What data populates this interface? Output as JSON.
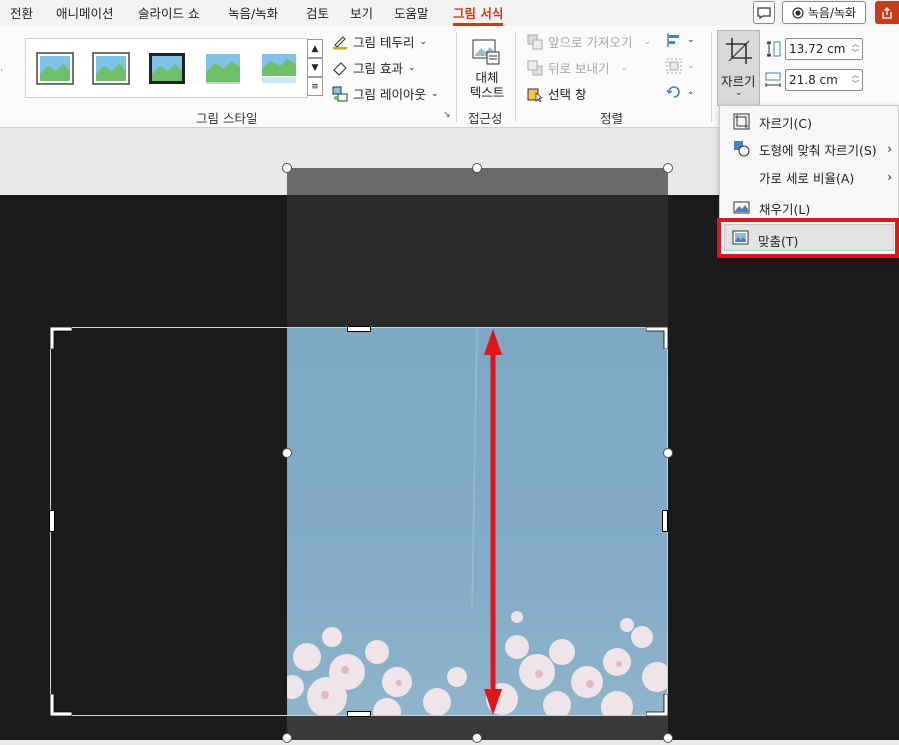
{
  "tabs": [
    {
      "label": "전환"
    },
    {
      "label": "애니메이션"
    },
    {
      "label": "슬라이드 쇼"
    },
    {
      "label": "녹음/녹화"
    },
    {
      "label": "검토"
    },
    {
      "label": "보기"
    },
    {
      "label": "도움말"
    },
    {
      "label": "그림 서식",
      "active": true
    }
  ],
  "titlebar": {
    "comment_icon": "comment-icon",
    "record_button": "녹음/녹화",
    "share_icon": "share-icon"
  },
  "ribbon": {
    "picture_styles": {
      "group_label": "그림 스타일",
      "styles_count_icon": "picture-style-thumbnail",
      "border": "그림 테두리",
      "effects": "그림 효과",
      "layout": "그림 레이아웃"
    },
    "accessibility": {
      "alt_text_line1": "대체",
      "alt_text_line2": "텍스트",
      "group_label": "접근성"
    },
    "arrange": {
      "bring_forward": "앞으로 가져오기",
      "send_backward": "뒤로 보내기",
      "selection_pane": "선택 창",
      "group_label": "정렬"
    },
    "crop": {
      "label": "자르기",
      "height": "13.72 cm",
      "width": "21.8 cm"
    }
  },
  "crop_menu": {
    "items": [
      {
        "label": "자르기(C)",
        "icon": "crop-icon",
        "submenu": false
      },
      {
        "label": "도형에 맞춰 자르기(S)",
        "icon": "crop-to-shape-icon",
        "submenu": true
      },
      {
        "label": "가로 세로 비율(A)",
        "icon": "",
        "submenu": true
      },
      {
        "label": "채우기(L)",
        "icon": "fill-icon",
        "submenu": false
      },
      {
        "label": "맞춤(T)",
        "icon": "fit-icon",
        "submenu": false,
        "highlighted": true
      }
    ]
  },
  "colors": {
    "accent": "#c43e1c",
    "highlight": "#e0141b",
    "arrow": "#e0141b"
  }
}
